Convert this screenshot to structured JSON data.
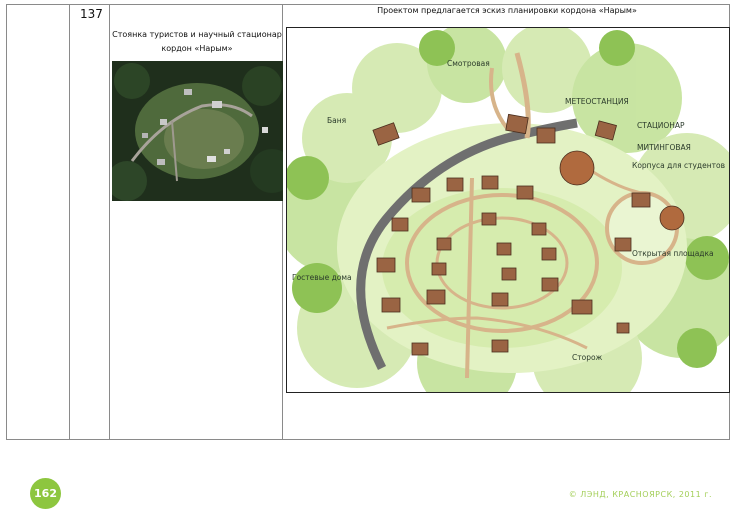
{
  "table": {
    "row_number": "137",
    "caption": "Стоянка туристов и научный стационар кордон «Нарым»",
    "sketch_title": "Проектом предлагается эскиз планировки кордона «Нарым»"
  },
  "sketch_labels": {
    "smotrovaya": "Смотровая",
    "banya": "Баня",
    "meteostantsiya": "МЕТЕОСТАНЦИЯ",
    "statsionar": "СТАЦИОНАР",
    "mitingovaya": "МИТИНГОВАЯ",
    "korpusa": "Корпуса для студентов",
    "gostinye_doma": "Гостевые дома",
    "otkrytaya_ploshchadka": "Открытая площадка",
    "storozh": "Сторож"
  },
  "footer": {
    "page_number": "162",
    "copyright": "© ЛЭНД, КРАСНОЯРСК, 2011 г."
  },
  "colors": {
    "badge": "#8dc63f",
    "footer_text": "#a4cf5a",
    "grass": "#b9dc7a",
    "forest": "#3f6b2e",
    "road": "#7a7a7a",
    "house": "#8b5a3c"
  }
}
